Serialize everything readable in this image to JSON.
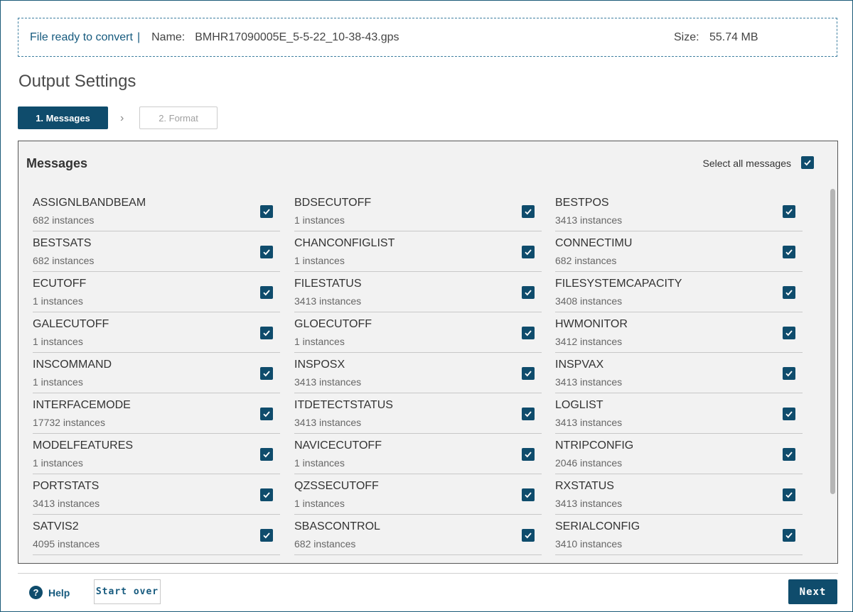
{
  "file": {
    "status": "File ready to convert",
    "separator": "|",
    "name_label": "Name:",
    "name": "BMHR17090005E_5-5-22_10-38-43.gps",
    "size_label": "Size:",
    "size": "55.74 MB"
  },
  "title": "Output Settings",
  "steps": [
    {
      "label": "1. Messages",
      "active": true
    },
    {
      "label": "2. Format",
      "active": false
    }
  ],
  "messages_panel": {
    "title": "Messages",
    "select_all_label": "Select all messages",
    "select_all_checked": true,
    "items": [
      {
        "name": "ASSIGNLBANDBEAM",
        "count": "682 instances",
        "checked": true
      },
      {
        "name": "BDSECUTOFF",
        "count": "1 instances",
        "checked": true
      },
      {
        "name": "BESTPOS",
        "count": "3413 instances",
        "checked": true
      },
      {
        "name": "BESTSATS",
        "count": "682 instances",
        "checked": true
      },
      {
        "name": "CHANCONFIGLIST",
        "count": "1 instances",
        "checked": true
      },
      {
        "name": "CONNECTIMU",
        "count": "682 instances",
        "checked": true
      },
      {
        "name": "ECUTOFF",
        "count": "1 instances",
        "checked": true
      },
      {
        "name": "FILESTATUS",
        "count": "3413 instances",
        "checked": true
      },
      {
        "name": "FILESYSTEMCAPACITY",
        "count": "3408 instances",
        "checked": true
      },
      {
        "name": "GALECUTOFF",
        "count": "1 instances",
        "checked": true
      },
      {
        "name": "GLOECUTOFF",
        "count": "1 instances",
        "checked": true
      },
      {
        "name": "HWMONITOR",
        "count": "3412 instances",
        "checked": true
      },
      {
        "name": "INSCOMMAND",
        "count": "1 instances",
        "checked": true
      },
      {
        "name": "INSPOSX",
        "count": "3413 instances",
        "checked": true
      },
      {
        "name": "INSPVAX",
        "count": "3413 instances",
        "checked": true
      },
      {
        "name": "INTERFACEMODE",
        "count": "17732 instances",
        "checked": true
      },
      {
        "name": "ITDETECTSTATUS",
        "count": "3413 instances",
        "checked": true
      },
      {
        "name": "LOGLIST",
        "count": "3413 instances",
        "checked": true
      },
      {
        "name": "MODELFEATURES",
        "count": "1 instances",
        "checked": true
      },
      {
        "name": "NAVICECUTOFF",
        "count": "1 instances",
        "checked": true
      },
      {
        "name": "NTRIPCONFIG",
        "count": "2046 instances",
        "checked": true
      },
      {
        "name": "PORTSTATS",
        "count": "3413 instances",
        "checked": true
      },
      {
        "name": "QZSSECUTOFF",
        "count": "1 instances",
        "checked": true
      },
      {
        "name": "RXSTATUS",
        "count": "3413 instances",
        "checked": true
      },
      {
        "name": "SATVIS2",
        "count": "4095 instances",
        "checked": true
      },
      {
        "name": "SBASCONTROL",
        "count": "682 instances",
        "checked": true
      },
      {
        "name": "SERIALCONFIG",
        "count": "3410 instances",
        "checked": true
      }
    ]
  },
  "footer": {
    "help_label": "Help",
    "start_over_label": "Start over",
    "next_label": "Next"
  },
  "colors": {
    "accent": "#0f4c6c",
    "link": "#165a7e",
    "panel_bg": "#f2f2f2"
  }
}
